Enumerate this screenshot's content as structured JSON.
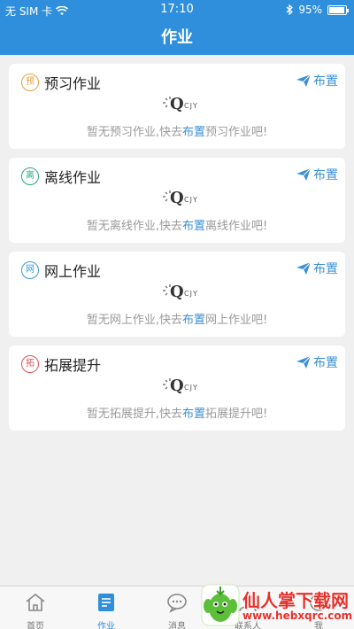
{
  "status": {
    "carrier": "无 SIM 卡",
    "time": "17:10",
    "battery": "95%"
  },
  "header": {
    "title": "作业"
  },
  "cards": [
    {
      "badge": "预",
      "title": "预习作业",
      "assign": "布置",
      "empty_prefix": "暂无预习作业,快去",
      "empty_link": "布置",
      "empty_suffix": "预习作业吧!",
      "color": "#e6a23c"
    },
    {
      "badge": "离",
      "title": "离线作业",
      "assign": "布置",
      "empty_prefix": "暂无离线作业,快去",
      "empty_link": "布置",
      "empty_suffix": "离线作业吧!",
      "color": "#2bab7a"
    },
    {
      "badge": "网",
      "title": "网上作业",
      "assign": "布置",
      "empty_prefix": "暂无网上作业,快去",
      "empty_link": "布置",
      "empty_suffix": "网上作业吧!",
      "color": "#3a9bd6"
    },
    {
      "badge": "拓",
      "title": "拓展提升",
      "assign": "布置",
      "empty_prefix": "暂无拓展提升,快去",
      "empty_link": "布置",
      "empty_suffix": "拓展提升吧!",
      "color": "#e05252"
    }
  ],
  "logo": {
    "letter": "Q",
    "sub": "CJY"
  },
  "tabs": [
    {
      "label": "首页",
      "icon": "home-icon"
    },
    {
      "label": "作业",
      "icon": "homework-icon",
      "active": true
    },
    {
      "label": "消息",
      "icon": "message-icon"
    },
    {
      "label": "联系人",
      "icon": "contacts-icon"
    },
    {
      "label": "我",
      "icon": "me-icon"
    }
  ],
  "watermark": {
    "text": "仙人掌下载网",
    "url": "www.hebxqrc.com"
  },
  "colors": {
    "primary": "#2f8fdc",
    "link": "#3a8fd6"
  }
}
